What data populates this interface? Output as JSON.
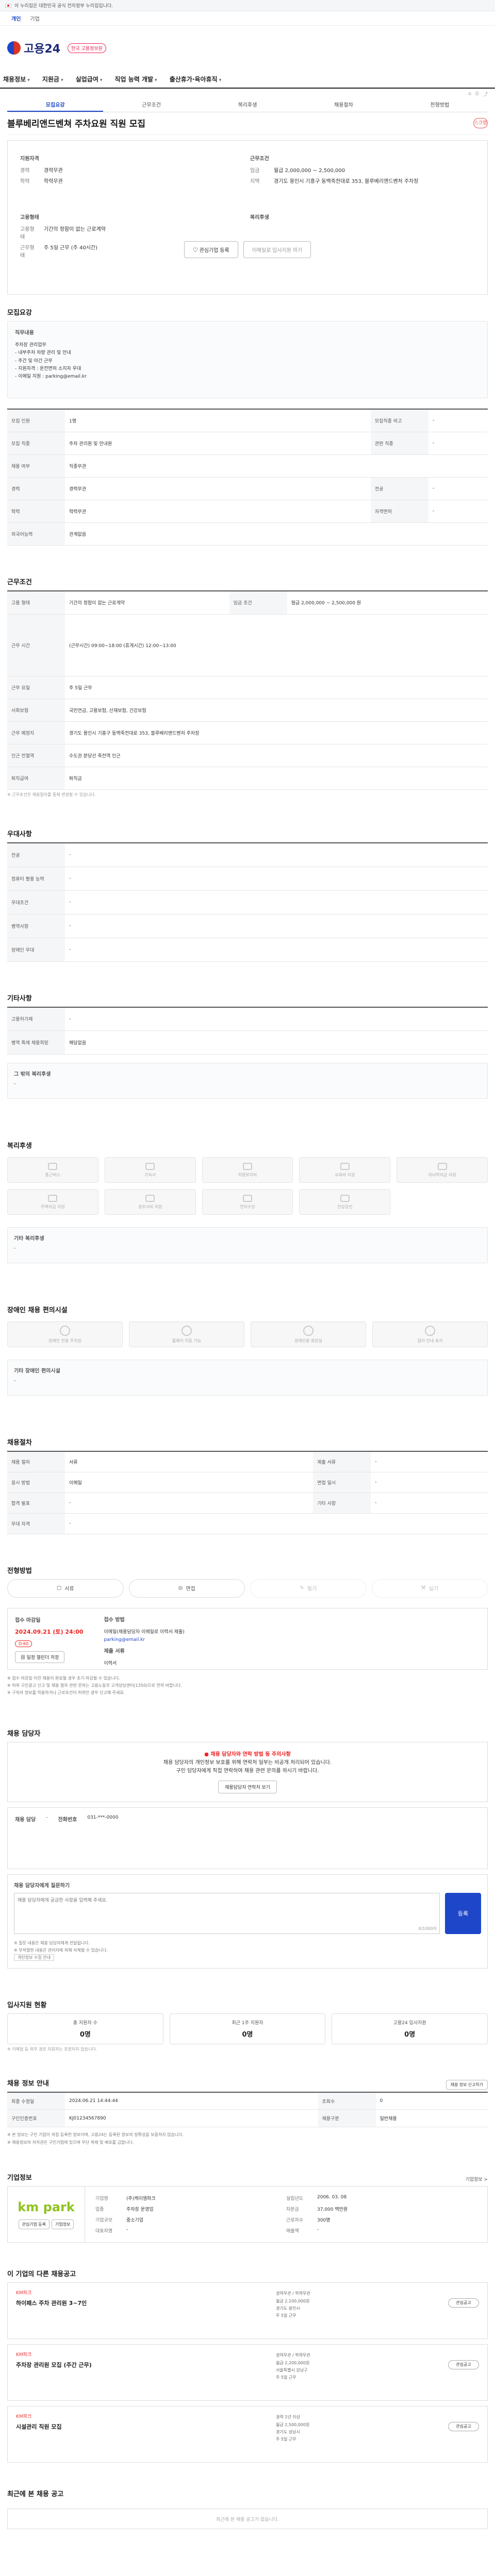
{
  "topbar": {
    "notice": "이 누리집은 대한민국 공식 전자정부 누리집입니다."
  },
  "tabs2": [
    "개인",
    "기업"
  ],
  "logo": {
    "name": "고용24",
    "badge": "한국 고용정보원"
  },
  "gnb": [
    "채용정보",
    "지원금",
    "실업급여",
    "직업 능력 개발",
    "출산휴가·육아휴직"
  ],
  "subtabs": [
    "모집요강",
    "근무조건",
    "복리후생",
    "채용절차",
    "전형방법"
  ],
  "job_title": "블루베리앤드벤쳐 주차요원 직원 모집",
  "scrap_label": "스크랩",
  "summary": {
    "left_title": "지원자격",
    "left_rows": [
      [
        "경력",
        "경력무관"
      ],
      [
        "학력",
        "학력무관"
      ]
    ],
    "right_title": "근무조건",
    "right_rows": [
      [
        "임금",
        "월급 2,000,000 ~ 2,500,000"
      ],
      [
        "지역",
        "경기도 용인시 기흥구 동백죽전대로 353, 블루베리앤드벤처 주차장"
      ]
    ],
    "left2_title": "고용형태",
    "left2_rows": [
      [
        "고용형태",
        "기간의 정함이 없는 근로계약"
      ],
      [
        "근무형태",
        "주 5일 근무 (주 40시간)"
      ]
    ],
    "right2_title": "복리후생",
    "btn_apply": "관심기업 등록",
    "btn_share": "이메일로 입사지원 하기"
  },
  "sec_recruit": {
    "title": "모집요강",
    "duty_label": "직무내용",
    "duty_lines": [
      "주차장 관리업무",
      "- 내부주차 차량 관리 및 안내",
      "- 주간 및 야간 근무",
      "- 지원자격 : 운전면허 소지자 우대",
      "- 이메일 지원 : parking@email.kr"
    ],
    "rows": [
      [
        "모집 인원",
        "1명"
      ],
      [
        "모집 직종",
        "주차 관리원 및 안내원"
      ],
      [
        "채용 여부",
        "직종무관"
      ],
      [
        "경력",
        "경력무관"
      ],
      [
        "학력",
        "학력무관"
      ],
      [
        "외국어능력",
        "관계없음"
      ]
    ],
    "right_rows": [
      [
        "모집직종 비고",
        "-"
      ],
      [
        "관련 직종",
        "-"
      ],
      [
        "전공",
        "-"
      ],
      [
        "자격면허",
        "-"
      ]
    ]
  },
  "sec_work": {
    "title": "근무조건",
    "rows": [
      [
        "고용 형태",
        "기간의 정함이 없는 근로계약"
      ],
      [
        "근무 시간",
        "(근무시간) 09:00~18:00 (휴게시간) 12:00~13:00"
      ],
      [
        "근무 요일",
        "주 5일 근무"
      ],
      [
        "사회보험",
        "국민연금, 고용보험, 산재보험, 건강보험"
      ],
      [
        "근무 예정지",
        "경기도 용인시 기흥구 동백죽전대로 353, 블루베리앤드벤처 주차장"
      ],
      [
        "인근 전철역",
        "수도권 분당선 죽전역 인근"
      ],
      [
        "퇴직급여",
        "퇴직금"
      ]
    ],
    "pay_label": "임금 조건",
    "pay_value": "월급 2,000,000 ~ 2,500,000 원",
    "note": "※ 근무조건은 채용절차를 통해 변경될 수 있습니다."
  },
  "sec_prefer": {
    "title": "우대사항",
    "rows": [
      [
        "전공",
        "-"
      ],
      [
        "컴퓨터 활용 능력",
        "-"
      ],
      [
        "우대조건",
        "-"
      ],
      [
        "병역사항",
        "-"
      ],
      [
        "장애인 우대",
        "-"
      ]
    ]
  },
  "sec_etc": {
    "title": "기타사항",
    "rows": [
      [
        "고용허가제",
        "-"
      ],
      [
        "병역 특례 채용희망",
        "해당없음"
      ]
    ],
    "other_label": "그 밖의 복리후생",
    "other_value": "-"
  },
  "sec_welfare": {
    "title": "복리후생",
    "tiles": [
      "통근버스",
      "기숙사",
      "차량유지비",
      "교육비 지원",
      "자녀학자금 지원",
      "주택자금 지원",
      "경조사비 지원",
      "연차수당",
      "건강검진"
    ],
    "other_label": "기타 복리후생",
    "other_value": "-"
  },
  "sec_disabled": {
    "title": "장애인 채용 편의시설",
    "tiles": [
      "장애인 전용 주차장",
      "휠체어 이동 가능",
      "장애인용 화장실",
      "점자 안내 표지"
    ],
    "other_label": "기타 장애인 편의시설",
    "other_value": "-"
  },
  "sec_process": {
    "title": "채용절차",
    "rows": [
      [
        "채용 절차",
        "서류",
        "제출 서류",
        "-"
      ],
      [
        "응시 방법",
        "이메일",
        "면접 일시",
        "-"
      ],
      [
        "합격 발표",
        "-",
        "기타 사항",
        "-"
      ],
      [
        "우대 자격",
        "-",
        "",
        ""
      ]
    ]
  },
  "sec_method": {
    "title": "전형방법",
    "methods": [
      "서류",
      "면접",
      "필기",
      "실기"
    ],
    "deadline_label": "접수 마감일",
    "deadline": "2024.09.21 (토) 24:00",
    "dday": "D-60",
    "way_label": "접수 방법",
    "way_value": "이메일(채용담당자 이메일로 이력서 제출)",
    "email": "parking@email.kr",
    "docs_label": "제출 서류",
    "docs_value": "이력서",
    "btn_cal": "일정 캘린더 저장",
    "notes": [
      "※ 접수 마감일 이전 채용이 완료될 경우 조기 마감될 수 있습니다.",
      "※ 허위 구인광고 신고 및 채용 절차 관련 문의는 고용노동부 고객상담센터(1350)으로 연락 바랍니다.",
      "※ 구직자 정보를 악용하거나 근로조건이 허위인 경우 신고해 주세요."
    ]
  },
  "sec_contact": {
    "title": "채용 담당자",
    "alert_title": "채용 담당자와 연락 방법 등 주의사항",
    "alert_lines": [
      "채용 담당자의 개인정보 보호를 위해 연락처 일부는 비공개 처리되어 있습니다.",
      "구인 담당자에게 직접 연락하여 채용 관련 문의를 하시기 바랍니다."
    ],
    "btn_contact": "채용담당자 연락처 보기",
    "rows": [
      [
        "채용 담당",
        "-",
        "전화번호",
        "031-***-0000"
      ]
    ],
    "q_label": "채용 담당자에게 질문하기",
    "q_placeholder": "채용 담당자에게 궁금한 사항을 입력해 주세요.",
    "q_counter": "0/1000자",
    "q_btn": "등록",
    "q_notes": [
      "※ 질문 내용은 채용 담당자에게 전달됩니다.",
      "※ 부적절한 내용은 관리자에 의해 삭제될 수 있습니다."
    ],
    "q_link": "개인정보 수집 안내"
  },
  "sec_stats": {
    "title": "입사지원 현황",
    "items": [
      [
        "총 지원자 수",
        "0명"
      ],
      [
        "최근 1주 지원자",
        "0명"
      ],
      [
        "고용24 입사지원",
        "0명"
      ]
    ],
    "note": "※ 이메일 등 외부 경로 지원자는 포함되지 않습니다."
  },
  "sec_info": {
    "title": "채용 정보 안내",
    "btn": "채용 정보 신고하기",
    "rows": [
      [
        "최종 수정일",
        "2024.06.21 14:44:44",
        "조회수",
        "0"
      ],
      [
        "구인인증번호",
        "KJ01234567890",
        "채용구분",
        "일반채용"
      ]
    ],
    "notes": [
      "※ 본 정보는 구인 기업이 직접 등록한 정보이며, 고용24는 등록된 정보의 정확성을 보증하지 않습니다.",
      "※ 채용정보의 저작권은 구인기업에 있으며 무단 복제 및 배포를 금합니다."
    ]
  },
  "sec_company": {
    "title": "기업정보",
    "more": "기업정보 >",
    "logo_text": "km park",
    "btn1": "관심기업 등록",
    "btn2": "기업정보",
    "fields": [
      [
        "기업명",
        "(주)케이엠파크",
        "설립년도",
        "2006. 03. 08"
      ],
      [
        "업종",
        "주차장 운영업",
        "자본금",
        "37,000 백만원"
      ],
      [
        "기업규모",
        "중소기업",
        "근로자수",
        "300명"
      ],
      [
        "대표자명",
        "-",
        "매출액",
        "-"
      ]
    ]
  },
  "sec_more_jobs": {
    "title": "이 기업의 다른 채용공고",
    "jobs": [
      {
        "co": "KM파크",
        "title": "하이패스 주차 관리원 3~7인",
        "meta": [
          "경력무관 / 학력무관",
          "월급 2,100,000원",
          "경기도 용인시",
          "주 5일 근무"
        ],
        "star": "관심공고"
      },
      {
        "co": "KM파크",
        "title": "주차장 관리원 모집 (주간 근무)",
        "meta": [
          "경력무관 / 학력무관",
          "월급 2,200,000원",
          "서울특별시 강남구",
          "주 5일 근무"
        ],
        "star": "관심공고"
      },
      {
        "co": "KM파크",
        "title": "시설관리 직원 모집",
        "meta": [
          "경력 1년 이상",
          "월급 2,500,000원",
          "경기도 성남시",
          "주 5일 근무"
        ],
        "star": "관심공고"
      }
    ]
  },
  "sec_recent": {
    "title": "최근에 본 채용 공고",
    "empty": "최근에 본 채용 공고가 없습니다."
  }
}
